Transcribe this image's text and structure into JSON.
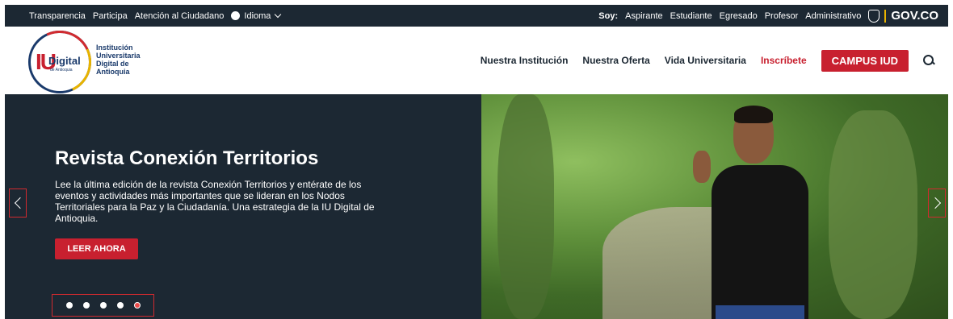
{
  "topbar": {
    "links": [
      "Transparencia",
      "Participa",
      "Atención al Ciudadano"
    ],
    "language_label": "Idioma",
    "soy_label": "Soy:",
    "roles": [
      "Aspirante",
      "Estudiante",
      "Egresado",
      "Profesor",
      "Administrativo"
    ],
    "gov_label": "GOV.CO"
  },
  "header": {
    "logo": {
      "iu": "IU",
      "digital": "Digital",
      "sub": "de Antioquia"
    },
    "institution_name": "Institución Universitaria Digital de Antioquia",
    "nav": [
      "Nuestra Institución",
      "Nuestra Oferta",
      "Vida Universitaria"
    ],
    "inscribete": "Inscríbete",
    "campus_button": "CAMPUS IUD"
  },
  "hero": {
    "title": "Revista Conexión Territorios",
    "text": "Lee la última edición de la revista Conexión Territorios y entérate de los eventos y actividades más importantes que se lideran en los Nodos Territoriales para la Paz y la Ciudadanía. Una estrategia de la IU Digital de Antioquia.",
    "cta_label": "LEER AHORA",
    "slide_count": 5,
    "active_slide": 5
  },
  "colors": {
    "dark": "#1c2833",
    "accent": "#c8202f",
    "navy": "#1a3a6b"
  }
}
